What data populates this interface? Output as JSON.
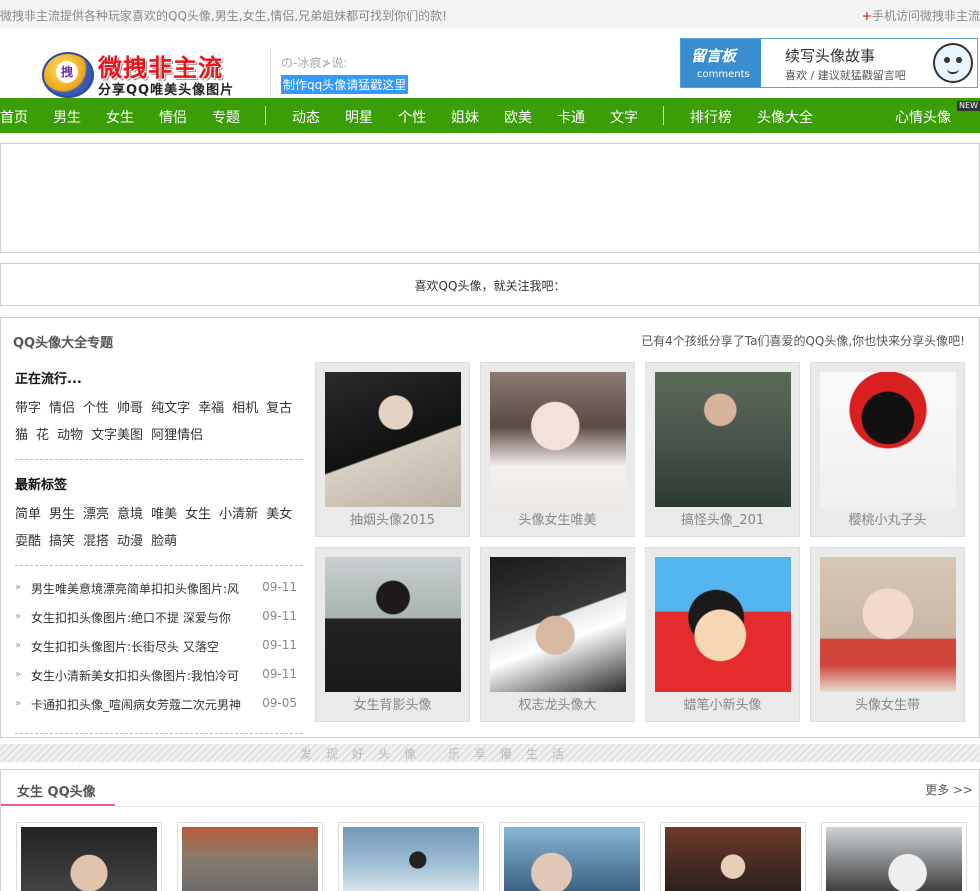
{
  "topbar": {
    "slogan": "微拽非主流提供各种玩家喜欢的QQ头像,男生,女生,情侣,兄弟姐妹都可找到你们的款!",
    "mobile_plus": "+",
    "mobile": "手机访问微拽非主流"
  },
  "logo": {
    "title": "微拽非主流",
    "subtitle": "分享QQ唯美头像图片",
    "badge_char": "拽"
  },
  "quote": {
    "who": "の-冰痕≯说:",
    "make_link": "制作qq头像请猛戳这里"
  },
  "message": {
    "tag_title": "留言板",
    "tag_sub": "comments",
    "title": "续写头像故事",
    "desc": "喜欢 / 建议就猛戳留言吧"
  },
  "nav": {
    "items": [
      "首页",
      "男生",
      "女生",
      "情侣",
      "专题",
      "动态",
      "明星",
      "个性",
      "姐妹",
      "欧美",
      "卡通",
      "文字",
      "排行榜",
      "头像大全",
      "心情头像"
    ],
    "new_badge": "NEW"
  },
  "follow": "喜欢QQ头像，就关注我吧：",
  "topics": {
    "title": "QQ头像大全专题",
    "share": "已有4个孩纸分享了Ta们喜爱的QQ头像,你也快来分享头像吧!",
    "popular_title": "正在流行...",
    "popular_tags": [
      "带字",
      "情侣",
      "个性",
      "帅哥",
      "纯文字",
      "幸福",
      "相机",
      "复古",
      "猫",
      "花",
      "动物",
      "文字美图",
      "阿狸情侣"
    ],
    "latest_title": "最新标签",
    "latest_tags": [
      "简单",
      "男生",
      "漂亮",
      "意境",
      "唯美",
      "女生",
      "小清新",
      "美女",
      "耍酷",
      "搞笑",
      "混搭",
      "动漫",
      "脸萌"
    ],
    "news": [
      {
        "title": "男生唯美意境漂亮简单扣扣头像图片:风",
        "date": "09-11"
      },
      {
        "title": "女生扣扣头像图片:绝口不提 深爱与你",
        "date": "09-11"
      },
      {
        "title": "女生扣扣头像图片:长街尽头 又落空",
        "date": "09-11"
      },
      {
        "title": "女生小清新美女扣扣头像图片:我怕冷可",
        "date": "09-11"
      },
      {
        "title": "卡通扣扣头像_喧闹病女芳蔻二次元男神",
        "date": "09-05"
      }
    ],
    "cards": [
      {
        "caption": "抽烟头像2015"
      },
      {
        "caption": "头像女生唯美"
      },
      {
        "caption": "搞怪头像_201"
      },
      {
        "caption": "樱桃小丸子头"
      },
      {
        "caption": "女生背影头像"
      },
      {
        "caption": "权志龙头像大"
      },
      {
        "caption": "蜡笔小新头像"
      },
      {
        "caption": "头像女生带"
      }
    ]
  },
  "strip": "发现好头像 乐享慢生活",
  "girls": {
    "title": "女生 QQ头像",
    "more": "更多 >>"
  },
  "colors": {
    "nav_green": "#3c9e07",
    "accent_pink": "#e8608a",
    "link_blue": "#3399ff"
  }
}
